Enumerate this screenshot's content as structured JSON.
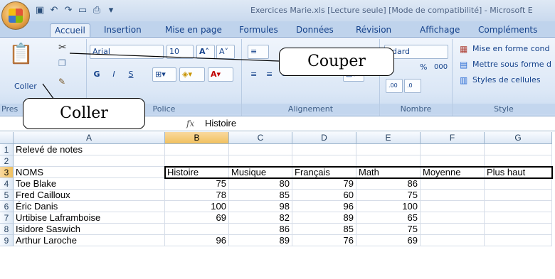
{
  "window": {
    "title": "Exercices Marie.xls  [Lecture seule]  [Mode de compatibilité] - Microsoft E"
  },
  "tabs": [
    "Accueil",
    "Insertion",
    "Mise en page",
    "Formules",
    "Données",
    "Révision",
    "Affichage",
    "Compléments"
  ],
  "ribbon": {
    "clipboard": {
      "paste_label": "Coller",
      "group_label": "Pres"
    },
    "font": {
      "name": "Arial",
      "size": "10",
      "bold": "G",
      "italic": "I",
      "underline": "S",
      "group_label": "Police"
    },
    "alignment": {
      "group_label": "Alignement"
    },
    "number": {
      "format": "ndard",
      "percent": "%",
      "thousands": "000",
      "group_label": "Nombre"
    },
    "style": {
      "items": [
        "Mise en forme cond",
        "Mettre sous forme d",
        "Styles de cellules"
      ],
      "group_label": "Style"
    }
  },
  "callouts": {
    "cut": "Couper",
    "paste": "Coller"
  },
  "formula_bar": {
    "fx": "fx",
    "value": "Histoire"
  },
  "sheet": {
    "columns": [
      "A",
      "B",
      "C",
      "D",
      "E",
      "F",
      "G"
    ],
    "rows": [
      {
        "n": "1",
        "cells": [
          "Relevé de notes",
          "",
          "",
          "",
          "",
          "",
          ""
        ]
      },
      {
        "n": "2",
        "cells": [
          "",
          "",
          "",
          "",
          "",
          "",
          ""
        ]
      },
      {
        "n": "3",
        "cells": [
          "NOMS",
          "Histoire",
          "Musique",
          "Français",
          "Math",
          "Moyenne",
          "Plus haut"
        ]
      },
      {
        "n": "4",
        "cells": [
          "Toe Blake",
          "75",
          "80",
          "79",
          "86",
          "",
          ""
        ]
      },
      {
        "n": "5",
        "cells": [
          "Fred Cailloux",
          "78",
          "85",
          "60",
          "75",
          "",
          ""
        ]
      },
      {
        "n": "6",
        "cells": [
          "Éric Danis",
          "100",
          "98",
          "96",
          "100",
          "",
          ""
        ]
      },
      {
        "n": "7",
        "cells": [
          "Urtibise Laframboise",
          "69",
          "82",
          "89",
          "65",
          "",
          ""
        ]
      },
      {
        "n": "8",
        "cells": [
          "Isidore Saswich",
          "",
          "86",
          "85",
          "75",
          "",
          ""
        ]
      },
      {
        "n": "9",
        "cells": [
          "Arthur Laroche",
          "96",
          "89",
          "76",
          "69",
          "",
          ""
        ]
      }
    ]
  }
}
